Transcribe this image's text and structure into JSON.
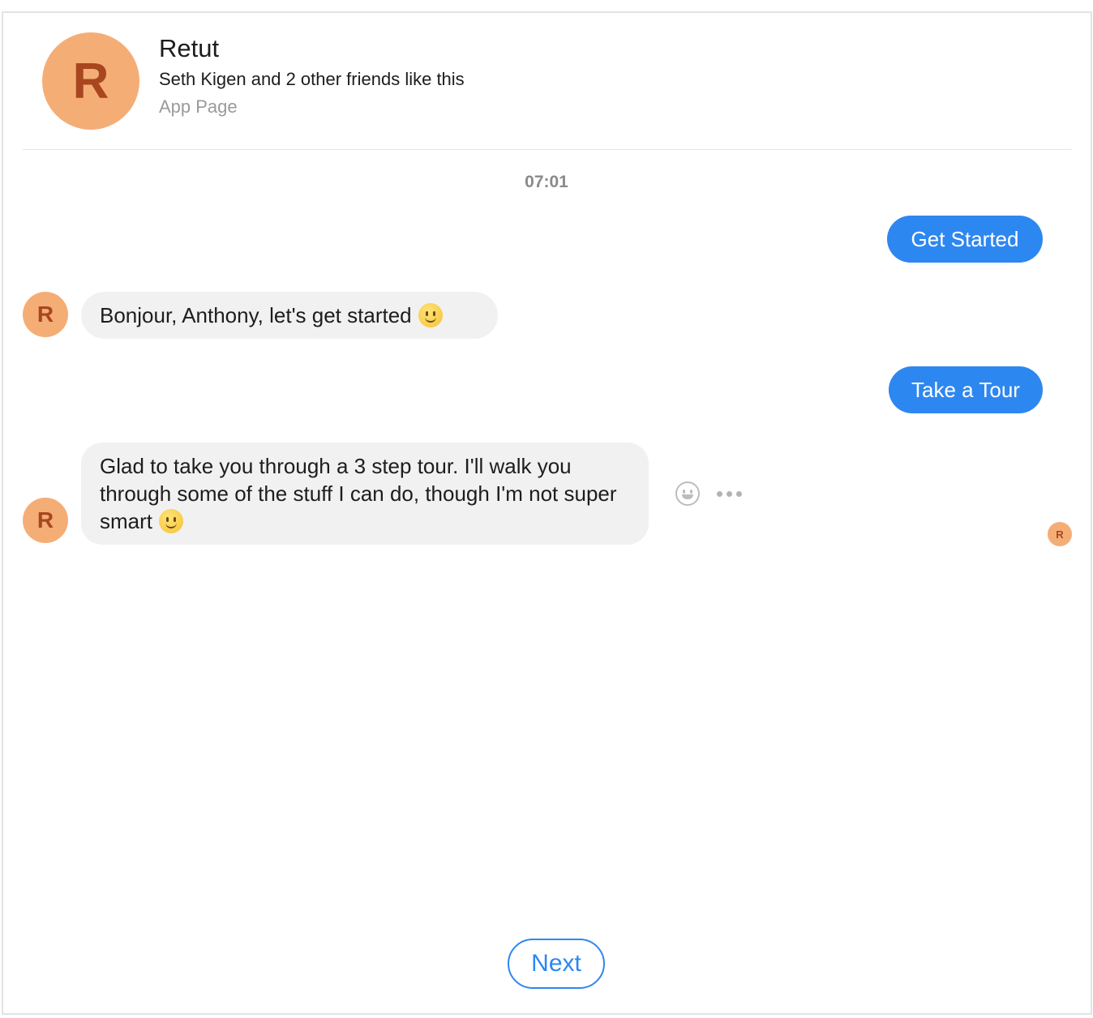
{
  "header": {
    "avatar_letter": "R",
    "page_name": "Retut",
    "friends_line": "Seth Kigen and 2 other friends like this",
    "page_type": "App Page"
  },
  "conversation": {
    "timestamp": "07:01",
    "messages": [
      {
        "direction": "outgoing",
        "text": "Get Started"
      },
      {
        "direction": "incoming",
        "avatar_letter": "R",
        "text": "Bonjour, Anthony, let's get started",
        "emoji": "smile-emoji"
      },
      {
        "direction": "outgoing",
        "text": "Take a Tour"
      },
      {
        "direction": "incoming",
        "avatar_letter": "R",
        "text": "Glad to take you through a 3 step tour. I'll walk you through some of the stuff I can do, though I'm not super smart",
        "emoji": "smile-emoji"
      }
    ],
    "seen_avatar_letter": "R",
    "actions": {
      "react_icon": "smiley-outline-icon",
      "more_icon": "ellipsis-icon"
    }
  },
  "quick_reply": {
    "next_label": "Next"
  },
  "colors": {
    "accent": "#2d87f0",
    "avatar_bg": "#f5ad76",
    "avatar_text": "#a8461f",
    "incoming_bubble": "#f1f1f1"
  }
}
